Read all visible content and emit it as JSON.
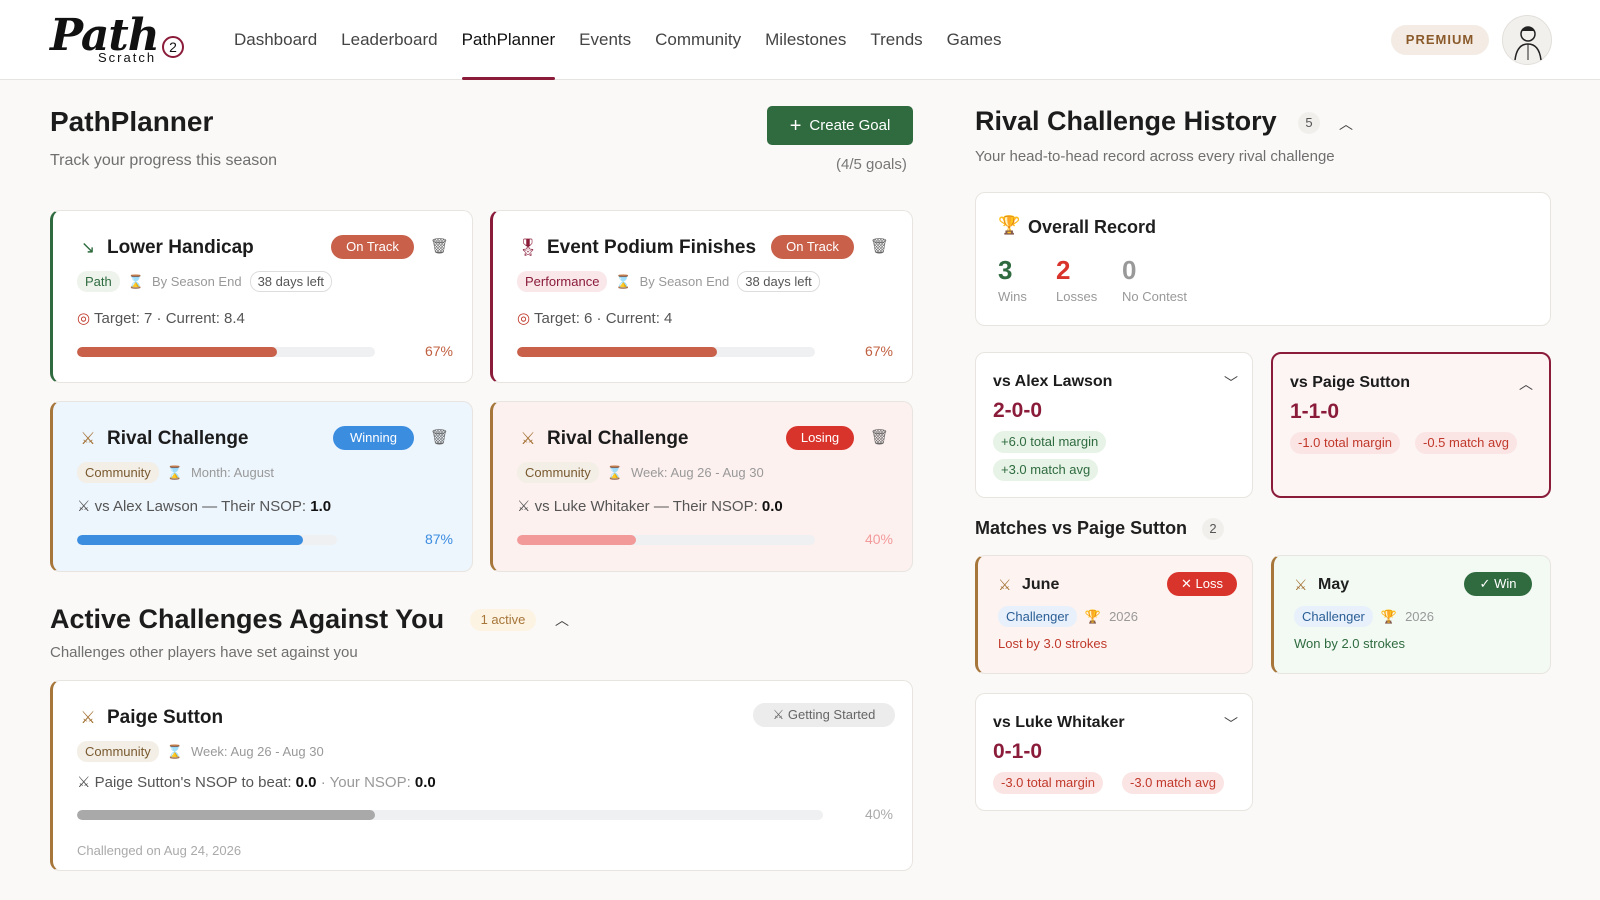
{
  "app": {
    "logo_text": "Path",
    "logo_sub": "Scratch",
    "logo_num": "2"
  },
  "nav": [
    {
      "label": "Dashboard"
    },
    {
      "label": "Leaderboard"
    },
    {
      "label": "PathPlanner",
      "active": true
    },
    {
      "label": "Events"
    },
    {
      "label": "Community"
    },
    {
      "label": "Milestones"
    },
    {
      "label": "Trends"
    },
    {
      "label": "Games"
    }
  ],
  "header": {
    "premium": "PREMIUM"
  },
  "planner": {
    "title": "PathPlanner",
    "subtitle": "Track your progress this season",
    "create_label": "Create Goal",
    "goals_count": "(4/5 goals)"
  },
  "goals": [
    {
      "title": "Lower Handicap",
      "badge": "On Track",
      "tag": "Path",
      "deadline": "By Season End",
      "days": "38 days left",
      "target": "Target: 7 · Current: 8.4",
      "progress": 0.67,
      "pct": "67%"
    },
    {
      "title": "Event Podium Finishes",
      "badge": "On Track",
      "tag": "Performance",
      "deadline": "By Season End",
      "days": "38 days left",
      "target": "Target: 6 · Current: 4",
      "progress": 0.67,
      "pct": "67%"
    },
    {
      "title": "Rival Challenge",
      "badge": "Winning",
      "tag": "Community",
      "deadline": "Month: August",
      "vs": "vs Alex Lawson — Their NSOP:",
      "vs_val": "1.0",
      "progress": 0.87,
      "pct": "87%"
    },
    {
      "title": "Rival Challenge",
      "badge": "Losing",
      "tag": "Community",
      "deadline": "Week: Aug 26 - Aug 30",
      "vs": "vs Luke Whitaker — Their NSOP:",
      "vs_val": "0.0",
      "progress": 0.4,
      "pct": "40%"
    }
  ],
  "against": {
    "title": "Active Challenges Against You",
    "count": "1 active",
    "subtitle": "Challenges other players have set against you",
    "card": {
      "name": "Paige Sutton",
      "status": "Getting Started",
      "tag": "Community",
      "deadline": "Week: Aug 26 - Aug 30",
      "beat_label": "Paige Sutton's NSOP to beat:",
      "beat_val": "0.0",
      "your_label": "· Your NSOP:",
      "your_val": "0.0",
      "progress": 0.4,
      "pct": "40%",
      "challenged": "Challenged on Aug 24, 2026"
    }
  },
  "history": {
    "title": "Rival Challenge History",
    "count": "5",
    "subtitle": "Your head-to-head record across every rival challenge",
    "overall": {
      "title": "Overall Record",
      "wins": "3",
      "wins_label": "Wins",
      "losses": "2",
      "losses_label": "Losses",
      "nc": "0",
      "nc_label": "No Contest"
    },
    "rivals": [
      {
        "name": "vs Alex Lawson",
        "score": "2-0-0",
        "m1": "+6.0 total margin",
        "m2": "+3.0 match avg"
      },
      {
        "name": "vs Paige Sutton",
        "score": "1-1-0",
        "m1": "-1.0 total margin",
        "m2": "-0.5 match avg"
      },
      {
        "name": "vs Luke Whitaker",
        "score": "0-1-0",
        "m1": "-3.0 total margin",
        "m2": "-3.0 match avg"
      }
    ],
    "matches_title": "Matches vs Paige Sutton",
    "matches_count": "2",
    "matches": [
      {
        "month": "June",
        "result": "Loss",
        "role": "Challenger",
        "year": "2026",
        "detail": "Lost by 3.0 strokes"
      },
      {
        "month": "May",
        "result": "Win",
        "role": "Challenger",
        "year": "2026",
        "detail": "Won by 2.0 strokes"
      }
    ]
  },
  "colors": {
    "accent": "#8a1c3a",
    "green": "#2f6b3f",
    "orange_bar": "#c8604a",
    "blue_bar": "#3b8de0",
    "pink_bar": "#f29a9a",
    "gray_bar": "#a9a9a9"
  }
}
